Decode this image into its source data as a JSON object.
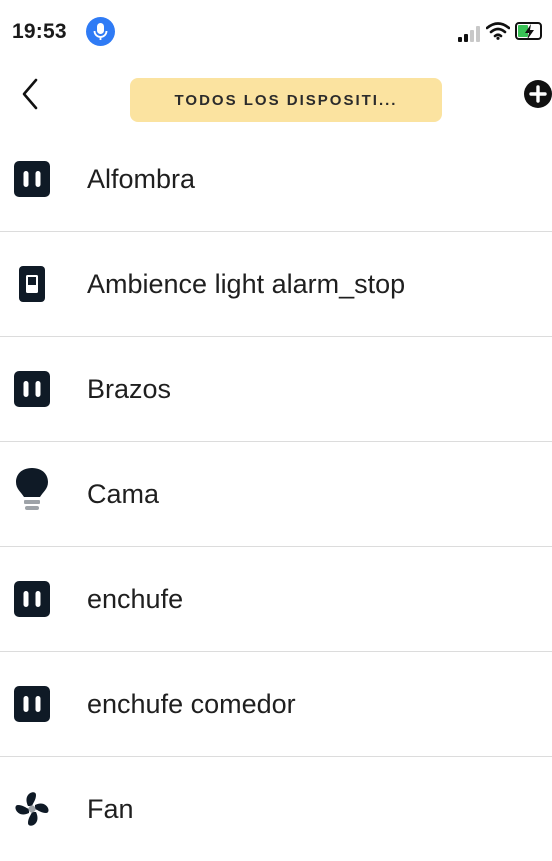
{
  "status_bar": {
    "time": "19:53"
  },
  "header": {
    "title": "TODOS LOS DISPOSITI..."
  },
  "devices": [
    {
      "name": "Alfombra",
      "icon": "smart-plug-icon"
    },
    {
      "name": "Ambience light alarm_stop",
      "icon": "light-switch-icon"
    },
    {
      "name": "Brazos",
      "icon": "smart-plug-icon"
    },
    {
      "name": "Cama",
      "icon": "light-bulb-icon"
    },
    {
      "name": "enchufe",
      "icon": "smart-plug-icon"
    },
    {
      "name": "enchufe comedor",
      "icon": "smart-plug-icon"
    },
    {
      "name": "Fan",
      "icon": "fan-icon"
    }
  ],
  "colors": {
    "title_pill": "#fbe3a0",
    "mic_badge": "#2f7bf5",
    "battery_fill": "#39c256",
    "divider": "#dcdcdc"
  }
}
